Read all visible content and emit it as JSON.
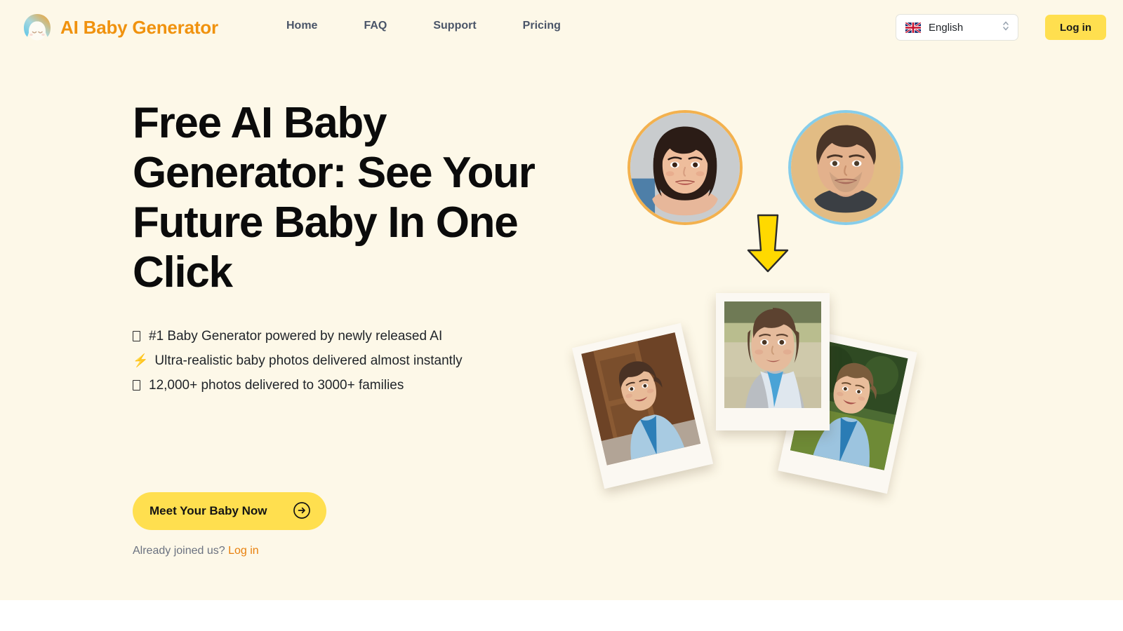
{
  "theme": {
    "hero_background": "#fdf8e8",
    "page_background": "#ffffff",
    "brand_orange": "#f0920e",
    "accent_yellow": "#ffdf4f",
    "link_orange": "#e8800d",
    "nav_text": "#4a5568",
    "heading_text": "#0b0b0b",
    "mother_ring": "#f3b14e",
    "father_ring": "#86cdea"
  },
  "header": {
    "brand": {
      "logo_icon": "baby-face-logo-icon",
      "name": "AI Baby Generator"
    },
    "nav": [
      {
        "label": "Home"
      },
      {
        "label": "FAQ"
      },
      {
        "label": "Support"
      },
      {
        "label": "Pricing"
      }
    ],
    "language_select": {
      "flag_icon": "uk-flag-icon",
      "selected": "English",
      "stepper_icon": "chevron-up-down-icon"
    },
    "login_button": {
      "label": "Log in"
    }
  },
  "hero": {
    "title": "Free AI Baby Generator: See Your Future Baby In One Click",
    "bullets": [
      {
        "glyph": "tofu-box",
        "text": "#1 Baby Generator powered by newly released AI"
      },
      {
        "glyph": "⚡",
        "text": "Ultra-realistic baby photos delivered almost instantly"
      },
      {
        "glyph": "tofu-box",
        "text": "12,000+ photos delivered to 3000+ families"
      }
    ],
    "cta": {
      "label": "Meet Your Baby Now",
      "arrow_icon": "circle-arrow-right-icon"
    },
    "login_prompt": {
      "text": "Already joined us? ",
      "link_label": "Log in"
    },
    "visual": {
      "mother_avatar": "mother-portrait",
      "father_avatar": "father-portrait",
      "arrow_icon": "down-arrow-icon",
      "polaroids": [
        {
          "name": "baby-photo-left"
        },
        {
          "name": "baby-photo-center"
        },
        {
          "name": "baby-photo-right"
        }
      ]
    }
  }
}
